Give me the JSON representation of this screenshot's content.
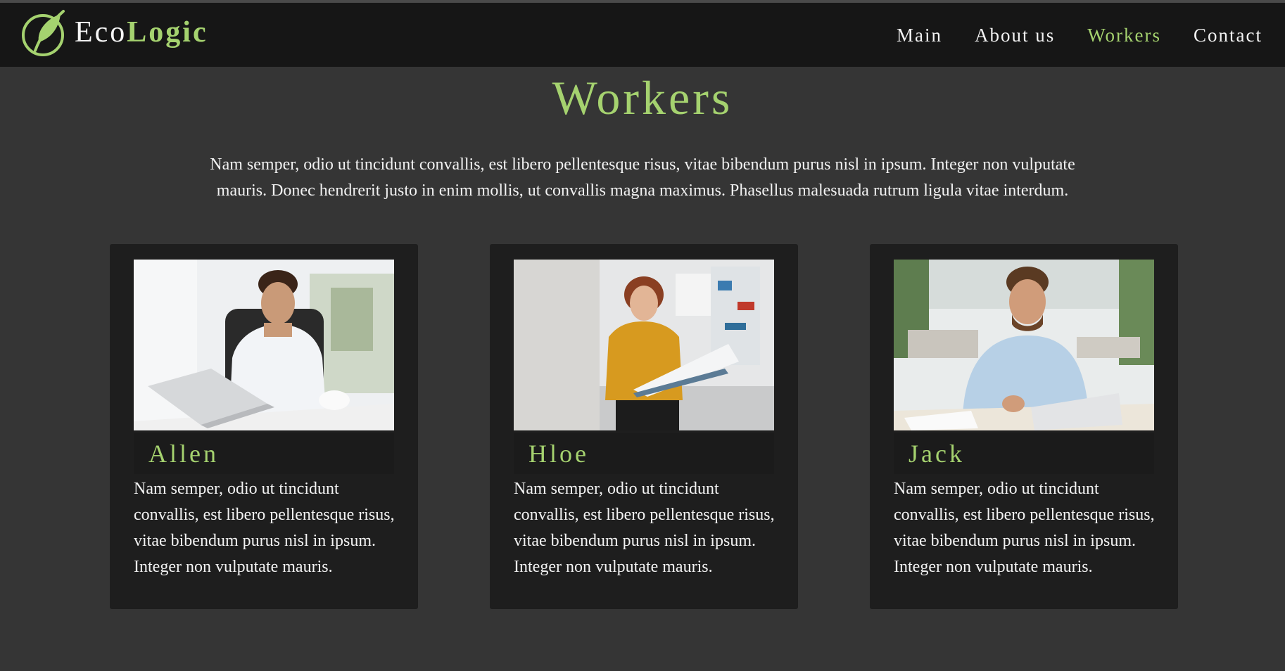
{
  "brand": {
    "name_plain": "Eco",
    "name_accent": "Logic",
    "logo_icon": "leaf-circle-icon"
  },
  "nav": [
    {
      "label": "Main",
      "active": false
    },
    {
      "label": "About us",
      "active": false
    },
    {
      "label": "Workers",
      "active": true
    },
    {
      "label": "Contact",
      "active": false
    }
  ],
  "page": {
    "title": "Workers",
    "intro": "Nam semper, odio ut tincidunt convallis, est libero pellentesque risus, vitae bibendum purus nisl in ipsum. Integer non vulputate mauris. Donec hendrerit justo in enim mollis, ut convallis magna maximus. Phasellus malesuada rutrum ligula vitae interdum."
  },
  "workers": [
    {
      "name": "Allen",
      "description": "Nam semper, odio ut tincidunt convallis, est libero pellentesque risus, vitae bibendum purus nisl in ipsum. Integer non vulputate mauris."
    },
    {
      "name": "Hloe",
      "description": "Nam semper, odio ut tincidunt convallis, est libero pellentesque risus, vitae bibendum purus nisl in ipsum. Integer non vulputate mauris."
    },
    {
      "name": "Jack",
      "description": "Nam semper, odio ut tincidunt convallis, est libero pellentesque risus, vitae bibendum purus nisl in ipsum. Integer non vulputate mauris."
    }
  ],
  "colors": {
    "accent": "#a5d26f",
    "background": "#353535",
    "header": "#161616",
    "card": "#1e1e1e"
  }
}
